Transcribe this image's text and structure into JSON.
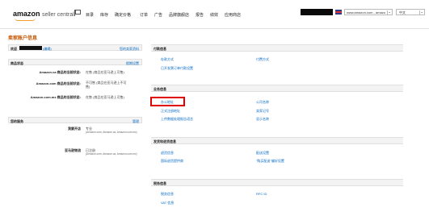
{
  "header": {
    "logo_main": "amazon",
    "logo_sub": "seller central",
    "nav": [
      "目录",
      "库存",
      "确定价格",
      "订单",
      "广告",
      "品牌旗舰店",
      "报告",
      "绩效",
      "应用商店"
    ],
    "marketplace": "www.amazon.com - amazo",
    "language": "中文"
  },
  "page": {
    "title": "卖家账户信息"
  },
  "left": {
    "welcome": {
      "prefix": "欢迎",
      "suffix": "(编辑)",
      "link": "您的卖家资料"
    },
    "listing_status": {
      "title": "商品状态",
      "link": "假期设置",
      "rows": [
        {
          "label": "Amazon.ca 商品的当前状态:",
          "value": "在售 (商品在亚马逊上可售)"
        },
        {
          "label": "Amazon.com 商品的当前状态:",
          "value": "不可售 (商品在亚马逊上不可售)"
        },
        {
          "label": "Amazon.com.mx 商品的当前状态:",
          "value": "在售 (商品在亚马逊上可售)"
        }
      ]
    },
    "services": {
      "title": "您的服务",
      "link": "管理",
      "rows": [
        {
          "label": "我要开店",
          "value": "专业",
          "sub": "(Amazon.com, Amazon.ca, Amazon.com.mx)"
        },
        {
          "label": "亚马逊物流",
          "value": "已注册",
          "sub": "(Amazon.com, Amazon.ca, Amazon.com.mx)"
        }
      ]
    }
  },
  "right": {
    "payment": {
      "title": "付款信息",
      "links": [
        "存款方式",
        "付费方式",
        "已开发票订单付款设置"
      ]
    },
    "business": {
      "title": "业务信息",
      "links": [
        "办公地址",
        "公司名称",
        "正式注册地址",
        "卖家记号",
        "上传数据处理报告语言",
        "显示名称"
      ]
    },
    "shipping": {
      "title": "发货和退货信息",
      "links": [
        "退货信息",
        "配送设置",
        "国际退货提供商",
        "\"购买配送\"偏好设置"
      ]
    },
    "tax": {
      "title": "税务信息",
      "links": [
        "税务信息",
        "RFC ID",
        "VAT 信息"
      ]
    }
  },
  "colors": {
    "link": "#0066c0",
    "title": "#c45500",
    "highlight": "#e00000"
  }
}
